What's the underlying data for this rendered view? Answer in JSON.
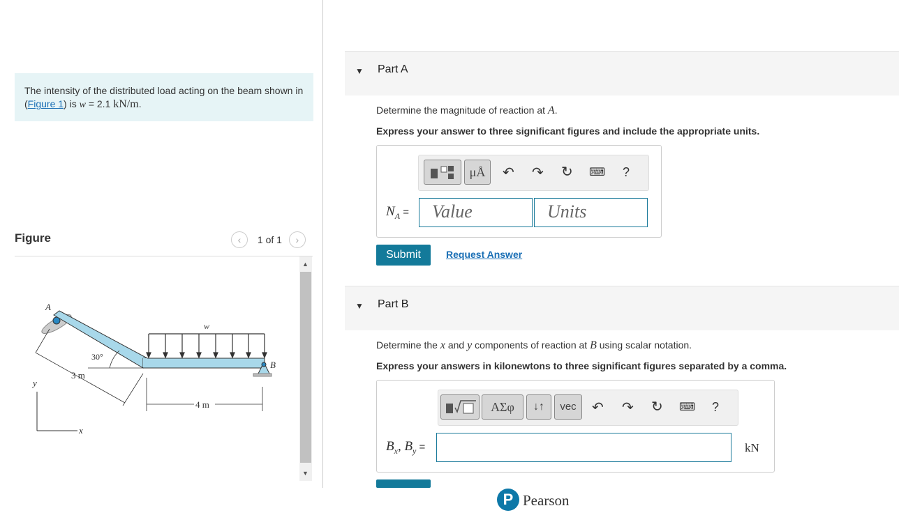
{
  "problem": {
    "text_before": "The intensity of the distributed load acting on the beam shown in (",
    "figure_link": "Figure 1",
    "text_after": ") is ",
    "w_symbol": "w",
    "equals": " = 2.1 ",
    "units": "kN/m",
    "period": "."
  },
  "figure": {
    "title": "Figure",
    "pager": "1 of 1",
    "labels": {
      "A": "A",
      "B": "B",
      "w": "w",
      "angle": "30°",
      "dist1": "3 m",
      "dist2": "4 m",
      "x": "x",
      "y": "y"
    }
  },
  "partA": {
    "label": "Part A",
    "question": "Determine the magnitude of reaction at ",
    "question_var": "A",
    "question_end": ".",
    "instruction": "Express your answer to three significant figures and include the appropriate units.",
    "var_label": "N",
    "var_sub": "A",
    "equals": " =",
    "value_placeholder": "Value",
    "units_placeholder": "Units",
    "toolbar_mu": "μÅ",
    "toolbar_help": "?",
    "submit": "Submit",
    "request": "Request Answer"
  },
  "partB": {
    "label": "Part B",
    "q1": "Determine the ",
    "qx": "x",
    "q2": " and ",
    "qy": "y",
    "q3": " components of reaction at ",
    "qB": "B",
    "q4": " using scalar notation.",
    "instruction": "Express your answers in kilonewtons to three significant figures separated by a comma.",
    "var_B": "B",
    "sub_x": "x",
    "sep": ", ",
    "sub_y": "y",
    "equals": " =",
    "units": "kN",
    "toolbar_greek": "ΑΣφ",
    "toolbar_arrows": "↓↑",
    "toolbar_vec": "vec",
    "toolbar_help": "?"
  },
  "footer": {
    "brand": "Pearson"
  }
}
